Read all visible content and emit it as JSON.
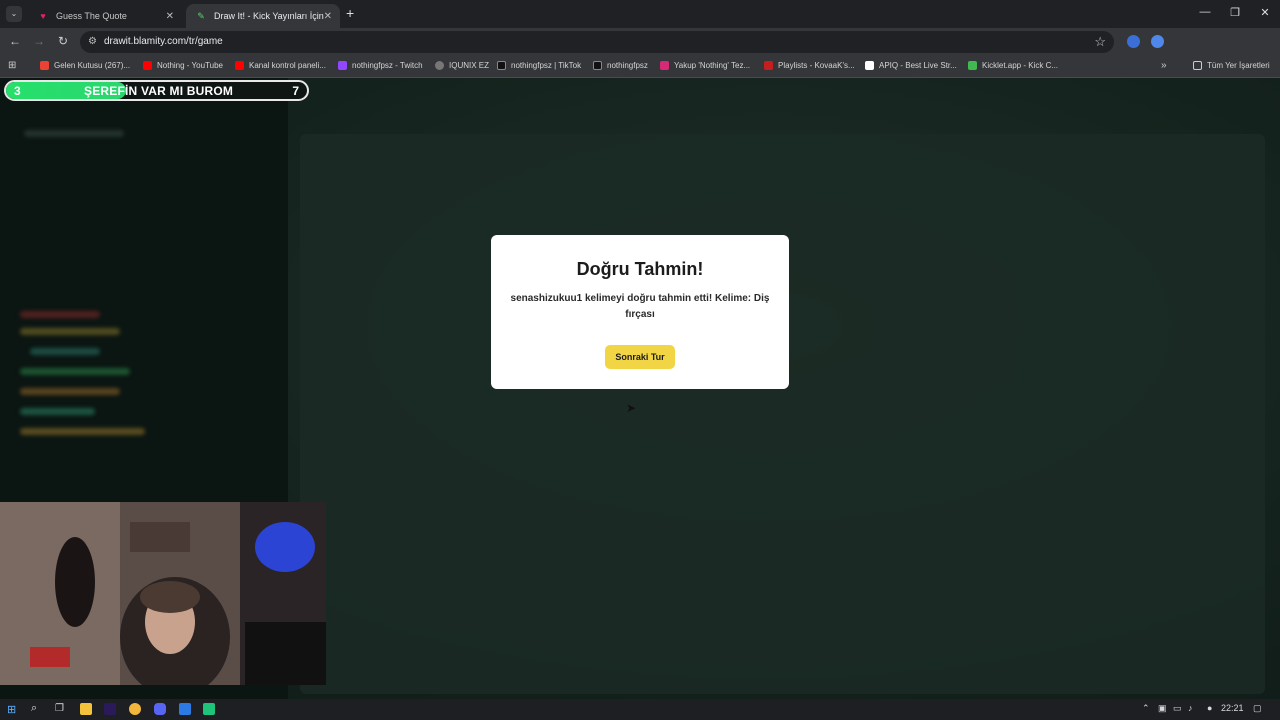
{
  "tabs": [
    {
      "title": "Guess The Quote",
      "favicon": "heart-favicon",
      "color": "#e0245e"
    },
    {
      "title": "Draw It! - Kick Yayınları İçin Çizi",
      "favicon": "pencil-favicon",
      "color": "#53d769"
    }
  ],
  "toolbar": {
    "url": "drawit.blamity.com/tr/game",
    "profile_initial": "Y"
  },
  "bookmarks": [
    {
      "label": "Gelen Kutusu (267)...",
      "icon": "gmail-icon",
      "color": "#ea4335"
    },
    {
      "label": "Nothing - YouTube",
      "icon": "youtube-icon",
      "color": "#ff0000"
    },
    {
      "label": "Kanal kontrol paneli...",
      "icon": "youtube-icon",
      "color": "#ff0000"
    },
    {
      "label": "nothingfpsz - Twitch",
      "icon": "twitch-icon",
      "color": "#9146ff"
    },
    {
      "label": "IQUNIX EZ",
      "icon": "globe-icon",
      "color": "#777777"
    },
    {
      "label": "nothingfpsz | TikTok",
      "icon": "tiktok-icon",
      "color": "#111111"
    },
    {
      "label": "nothingfpsz",
      "icon": "x-icon",
      "color": "#111111"
    },
    {
      "label": "Yakup 'Nothing' Tez...",
      "icon": "instagram-icon",
      "color": "#d62976"
    },
    {
      "label": "Playlists - KovaaK's...",
      "icon": "kovaaks-icon",
      "color": "#c41e1e"
    },
    {
      "label": "APIQ - Best Live Str...",
      "icon": "apiq-icon",
      "color": "#ffffff"
    },
    {
      "label": "Kicklet.app - Kick C...",
      "icon": "kicklet-icon",
      "color": "#3fb950"
    }
  ],
  "bookmarks_folder": "Tüm Yer İşaretleri",
  "game": {
    "level_left": "3",
    "level_right": "7",
    "progress_title": "ŞEREFİN VAR MI BUROM",
    "progress_fraction": 0.4
  },
  "modal": {
    "title": "Doğru Tahmin!",
    "message": "senashizukuu1 kelimeyi doğru tahmin etti! Kelime: Diş fırçası",
    "button": "Sonraki Tur"
  },
  "taskbar": {
    "time": "22:21"
  }
}
